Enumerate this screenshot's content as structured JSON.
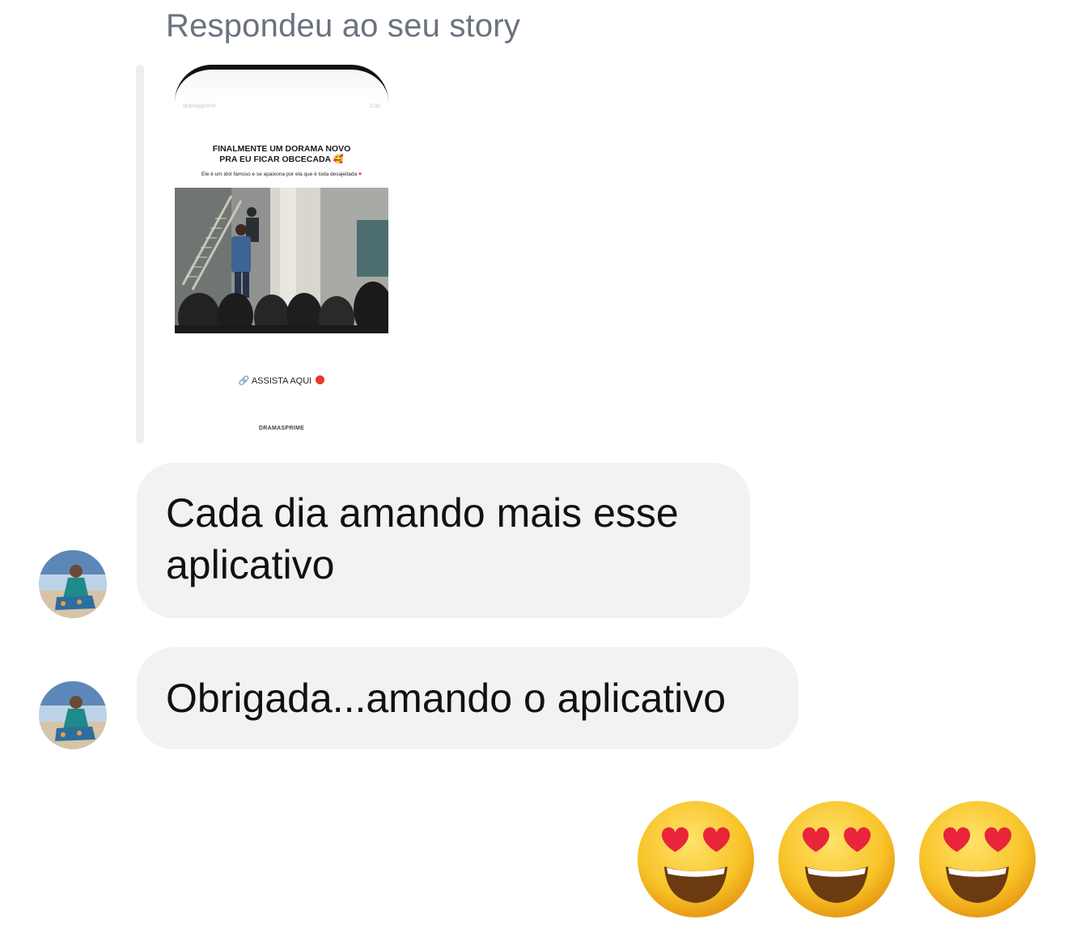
{
  "header": {
    "reply_label": "Respondeu ao seu story"
  },
  "story": {
    "top_left": "dramasprime",
    "top_right": "1:00",
    "headline_line1": "FINALMENTE UM DORAMA NOVO",
    "headline_line2": "PRA EU FICAR OBCECADA",
    "caption": "Ele é um idol famoso e se apaixona por ela que é toda desajeitada",
    "cta": "ASSISTA AQUI",
    "brand": "DRAMASPRIME"
  },
  "messages": [
    {
      "text": "Cada dia amando mais esse aplicativo"
    },
    {
      "text": "Obrigada...amando o aplicativo"
    }
  ],
  "reactions": {
    "emojis": [
      "smiling-face-with-heart-eyes",
      "smiling-face-with-heart-eyes",
      "smiling-face-with-heart-eyes"
    ]
  },
  "colors": {
    "bubble_bg": "#f1f2f4",
    "label_gray": "#6b7280",
    "emoji_face": "#f8c328",
    "heart": "#e8253b"
  }
}
